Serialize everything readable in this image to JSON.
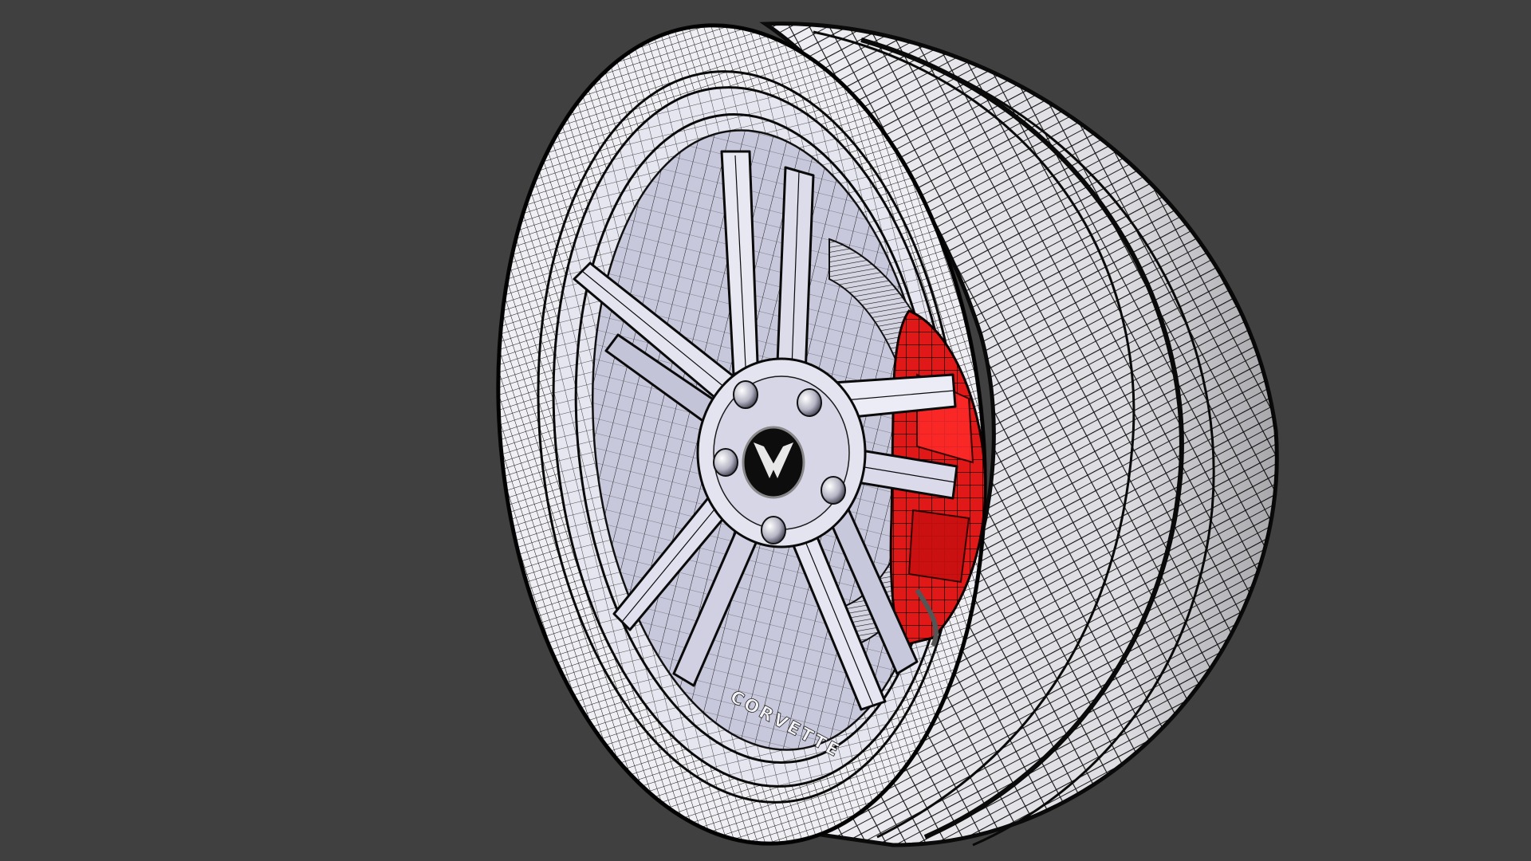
{
  "scene": {
    "background_color": "#404040",
    "render_style": "wireframe-on-shaded",
    "subject": "wheel-with-tire-and-brake"
  },
  "colors": {
    "tire_light": "#f2f2f6",
    "tire_shadow": "#a8a8c0",
    "rim_light": "#ececf4",
    "rim_shadow": "#8e8ea8",
    "caliper": "#e01818",
    "caliper_dark": "#7a0606",
    "wire": "#111111",
    "emblem_bg": "#0d0d0d",
    "emblem_fg": "#e8e8e8"
  },
  "rim": {
    "spoke_pairs": 5,
    "lug_nuts": 5,
    "center_emblem_icon": "crossed-flags-emblem-icon"
  },
  "sidewall_text": "CORVETTE"
}
